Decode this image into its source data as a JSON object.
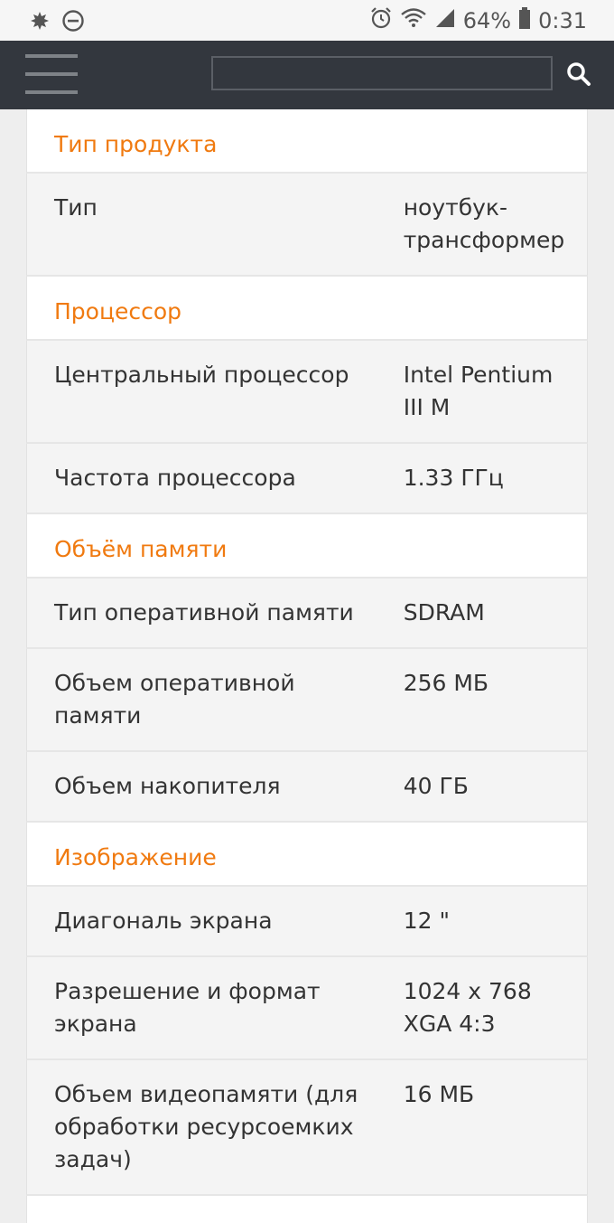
{
  "status_bar": {
    "battery": "64%",
    "time": "0:31",
    "icons": [
      "leaf-icon",
      "do-not-disturb-icon",
      "alarm-icon",
      "wifi-icon",
      "signal-icon",
      "battery-icon"
    ]
  },
  "header": {
    "search": {
      "value": "",
      "placeholder": ""
    },
    "icons": [
      "hamburger-menu-icon",
      "search-icon"
    ]
  },
  "colors": {
    "header_bg": "#33373e",
    "section_title": "#f07a10",
    "row_bg": "#f4f4f4"
  },
  "sections": [
    {
      "title": "Тип продукта",
      "rows": [
        {
          "name": "Тип",
          "value": "ноутбук-трансформер"
        }
      ]
    },
    {
      "title": "Процессор",
      "rows": [
        {
          "name": "Центральный процессор",
          "value": "Intel Pentium III M"
        },
        {
          "name": "Частота процессора",
          "value": "1.33 ГГц"
        }
      ]
    },
    {
      "title": "Объём памяти",
      "rows": [
        {
          "name": "Тип оперативной памяти",
          "value": "SDRAM"
        },
        {
          "name": "Объем оперативной памяти",
          "value": "256 МБ"
        },
        {
          "name": "Объем накопителя",
          "value": "40 ГБ"
        }
      ]
    },
    {
      "title": "Изображение",
      "rows": [
        {
          "name": "Диагональ экрана",
          "value": "12 \""
        },
        {
          "name": "Разрешение и формат экрана",
          "value": "1024 x 768 XGA 4:3"
        },
        {
          "name": "Объем видеопамяти (для обработки ресурсоемких задач)",
          "value": "16 МБ"
        }
      ]
    }
  ]
}
